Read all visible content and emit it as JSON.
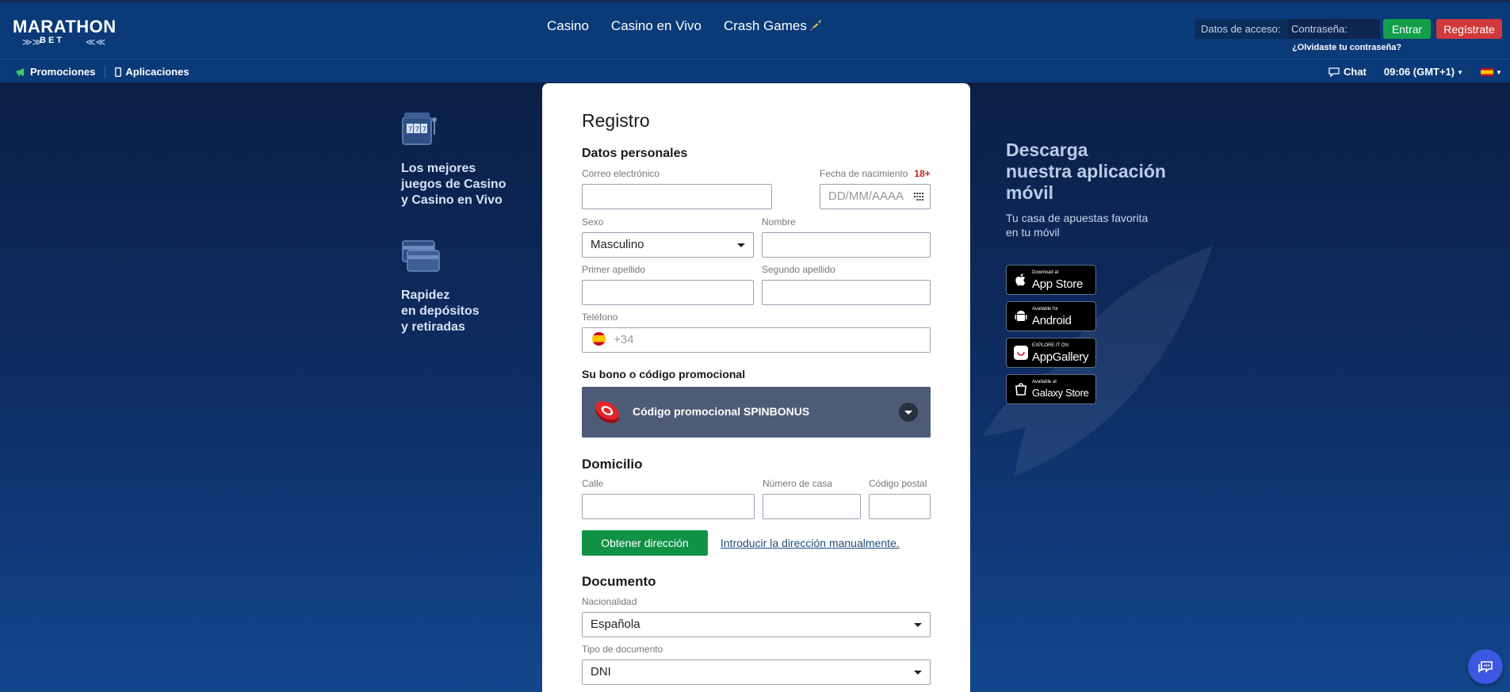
{
  "header": {
    "logo_main": "MARATHON",
    "logo_sub": "BET",
    "nav": [
      "Casino",
      "Casino en Vivo",
      "Crash Games"
    ],
    "login_label": "Datos de acceso:",
    "password_placeholder": "Contraseña:",
    "entrar_label": "Entrar",
    "registrate_label": "Regístrate",
    "forgot_label": "¿Olvidaste tu contraseña?"
  },
  "subbar": {
    "promociones": "Promociones",
    "aplicaciones": "Aplicaciones",
    "chat": "Chat",
    "time": "09:06 (GMT+1)"
  },
  "features": [
    {
      "text_lines": [
        "Los mejores",
        "juegos de Casino",
        "y Casino en Vivo"
      ],
      "icon": "slot-machine-icon"
    },
    {
      "text_lines": [
        "Rapidez",
        "en depósitos",
        "y retiradas"
      ],
      "icon": "cards-icon"
    }
  ],
  "form": {
    "title": "Registro",
    "personal_title": "Datos personales",
    "email_label": "Correo electrónico",
    "email_value": "",
    "birth_label": "Fecha de nacimiento",
    "birth_age": "18+",
    "birth_placeholder": "DD/MM/AAAA",
    "sexo_label": "Sexo",
    "sexo_value": "Masculino",
    "nombre_label": "Nombre",
    "apellido1_label": "Primer apellido",
    "apellido2_label": "Segundo apellido",
    "telefono_label": "Teléfono",
    "telefono_prefix": "+34",
    "bono_title": "Su bono o código promocional",
    "promo_text": "Código promocional SPINBONUS",
    "domicilio_title": "Domicilio",
    "calle_label": "Calle",
    "numero_label": "Número de casa",
    "postal_label": "Código postal",
    "obtener_label": "Obtener dirección",
    "manual_link": "Introducir la dirección manualmente.",
    "documento_title": "Documento",
    "nacionalidad_label": "Nacionalidad",
    "nacionalidad_value": "Española",
    "tipo_doc_label": "Tipo de documento",
    "tipo_doc_value": "DNI"
  },
  "app_promo": {
    "title_lines": [
      "Descarga",
      "nuestra aplicación",
      "móvil"
    ],
    "subtitle_lines": [
      "Tu casa de apuestas favorita",
      "en tu móvil"
    ],
    "stores": [
      {
        "small": "Download at",
        "big": "App Store",
        "icon": "apple-icon"
      },
      {
        "small": "Available for",
        "big": "Android",
        "icon": "android-icon"
      },
      {
        "small": "EXPLORE IT ON",
        "big": "AppGallery",
        "icon": "huawei-icon"
      },
      {
        "small": "Available at",
        "big": "Galaxy Store",
        "icon": "galaxy-store-icon"
      }
    ]
  },
  "colors": {
    "header_bg": "#0a3a78",
    "green": "#129e4a",
    "red": "#d13a3a",
    "promo_bg": "#4d5b77"
  }
}
